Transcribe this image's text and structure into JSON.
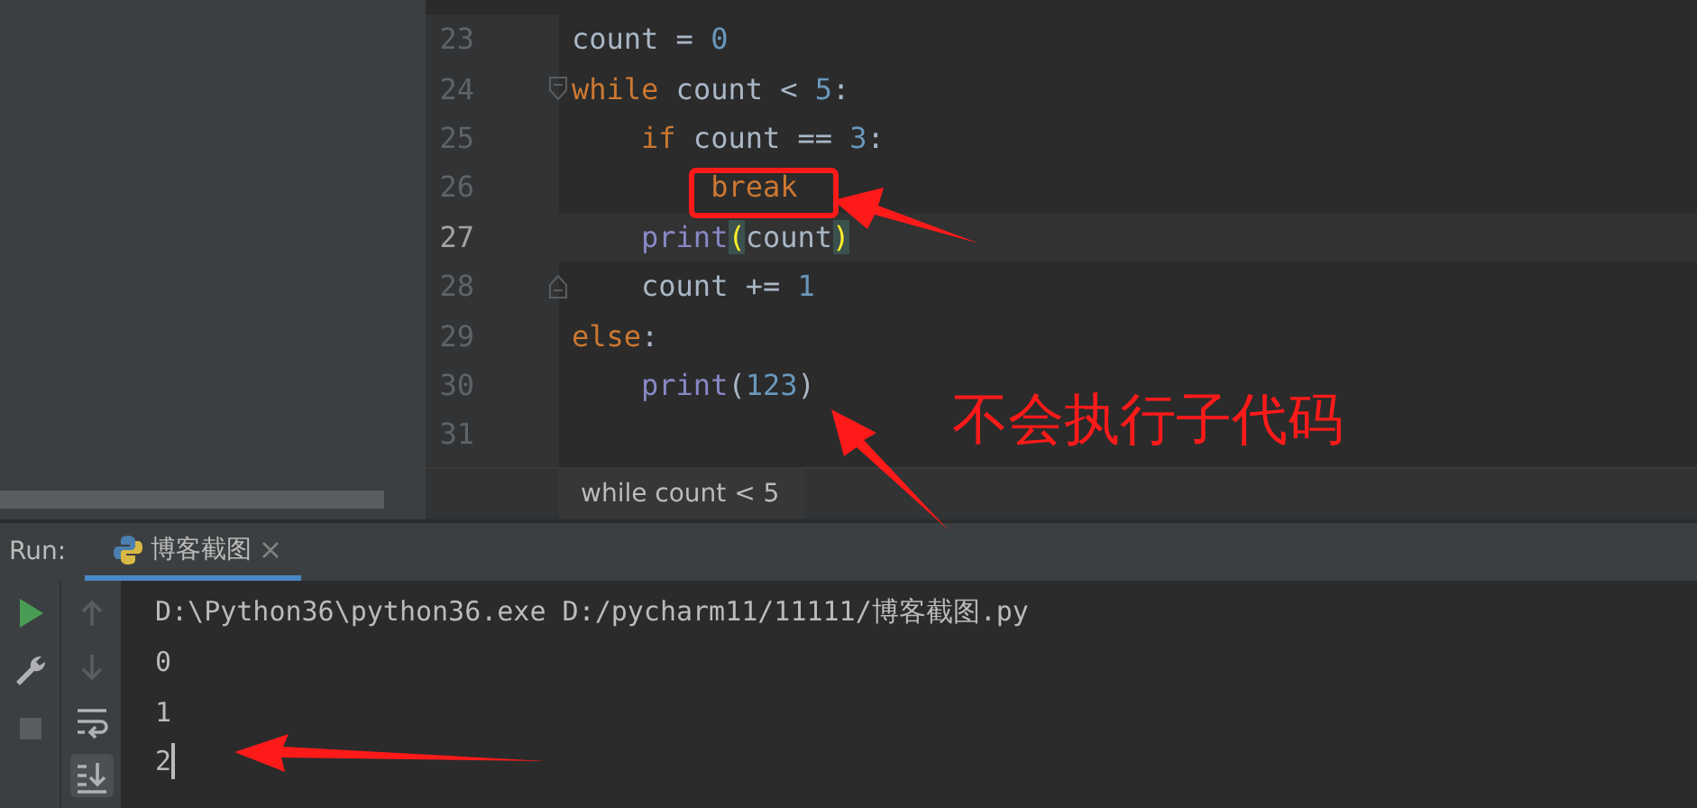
{
  "editor": {
    "lines": [
      {
        "number": "23",
        "current": false,
        "fold_start": false,
        "fold_end": false,
        "tokens": [
          {
            "text": "count = ",
            "kind": "plain"
          },
          {
            "text": "0",
            "kind": "num"
          }
        ]
      },
      {
        "number": "24",
        "current": false,
        "fold_start": true,
        "fold_end": false,
        "tokens": [
          {
            "text": "while",
            "kind": "kw"
          },
          {
            "text": " count < ",
            "kind": "plain"
          },
          {
            "text": "5",
            "kind": "num"
          },
          {
            "text": ":",
            "kind": "plain"
          }
        ]
      },
      {
        "number": "25",
        "current": false,
        "fold_start": false,
        "fold_end": false,
        "tokens": [
          {
            "text": "    if",
            "kind": "kw"
          },
          {
            "text": " count == ",
            "kind": "plain"
          },
          {
            "text": "3",
            "kind": "num"
          },
          {
            "text": ":",
            "kind": "plain"
          }
        ]
      },
      {
        "number": "26",
        "current": false,
        "fold_start": false,
        "fold_end": false,
        "tokens": [
          {
            "text": "        break",
            "kind": "kw"
          }
        ]
      },
      {
        "number": "27",
        "current": true,
        "fold_start": false,
        "fold_end": false,
        "tokens": [
          {
            "text": "    print",
            "kind": "fn"
          },
          {
            "text": "(",
            "kind": "match"
          },
          {
            "text": "count",
            "kind": "plain"
          },
          {
            "text": ")",
            "kind": "match"
          }
        ]
      },
      {
        "number": "28",
        "current": false,
        "fold_start": false,
        "fold_end": true,
        "tokens": [
          {
            "text": "    count += ",
            "kind": "plain"
          },
          {
            "text": "1",
            "kind": "num"
          }
        ]
      },
      {
        "number": "29",
        "current": false,
        "fold_start": false,
        "fold_end": false,
        "tokens": [
          {
            "text": "else",
            "kind": "kw"
          },
          {
            "text": ":",
            "kind": "plain"
          }
        ]
      },
      {
        "number": "30",
        "current": false,
        "fold_start": false,
        "fold_end": false,
        "tokens": [
          {
            "text": "    print",
            "kind": "fn"
          },
          {
            "text": "(",
            "kind": "plain"
          },
          {
            "text": "123",
            "kind": "num"
          },
          {
            "text": ")",
            "kind": "plain"
          }
        ]
      },
      {
        "number": "31",
        "current": false,
        "fold_start": false,
        "fold_end": false
      }
    ],
    "breadcrumb": "while count < 5"
  },
  "run_panel": {
    "label": "Run:",
    "tabs": [
      {
        "label": "博客截图",
        "selected": true
      }
    ],
    "tools_left": [
      {
        "kind": "run"
      },
      {
        "kind": "settings"
      },
      {
        "kind": "stop"
      }
    ],
    "tools_right": [
      {
        "kind": "up",
        "selected": false
      },
      {
        "kind": "down",
        "selected": false
      },
      {
        "kind": "wrap",
        "selected": false
      },
      {
        "kind": "scroll-end",
        "selected": true
      }
    ],
    "output": [
      "D:\\Python36\\python36.exe D:/pycharm11/11111/博客截图.py",
      "0",
      "1",
      "2"
    ]
  },
  "annotation": {
    "note": "不会执行子代码"
  }
}
